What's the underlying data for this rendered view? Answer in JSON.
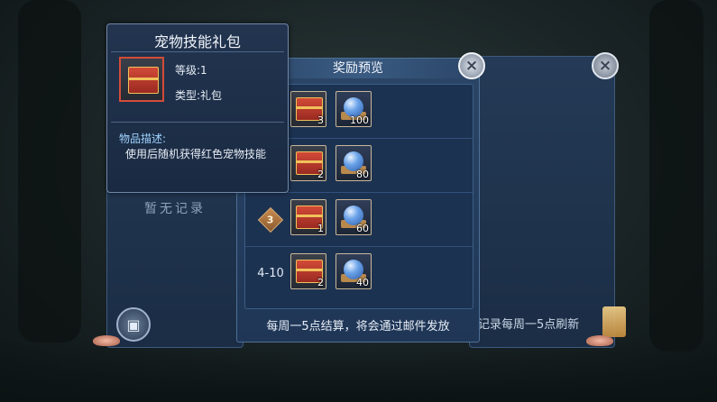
{
  "tooltip": {
    "title": "宠物技能礼包",
    "level_label": "等级:1",
    "type_label": "类型:礼包",
    "desc_label": "物品描述:",
    "desc_text": "使用后随机获得红色宠物技能"
  },
  "back_panel": {
    "no_record": "暂无记录",
    "refresh_note": "记录每周一5点刷新"
  },
  "reward_preview": {
    "title": "奖励预览",
    "close_icon": "×",
    "footer": "每周一5点结算，将会通过邮件发放",
    "rows": [
      {
        "rank": "",
        "items": [
          {
            "icon": "gift-box",
            "count": "3"
          },
          {
            "icon": "crystal-orb",
            "count": "100"
          }
        ]
      },
      {
        "rank": "",
        "items": [
          {
            "icon": "gift-box",
            "count": "2"
          },
          {
            "icon": "crystal-orb",
            "count": "80"
          }
        ]
      },
      {
        "rank": "3",
        "items": [
          {
            "icon": "gift-box",
            "count": "1"
          },
          {
            "icon": "crystal-orb",
            "count": "60"
          }
        ]
      },
      {
        "rank": "4-10",
        "items": [
          {
            "icon": "gift-box",
            "count": "2"
          },
          {
            "icon": "crystal-orb",
            "count": "40"
          }
        ]
      }
    ]
  },
  "colors": {
    "panel": "#1f3656",
    "border": "#4e7096",
    "badge": "#c98b4e",
    "gift": "#d24a37"
  }
}
